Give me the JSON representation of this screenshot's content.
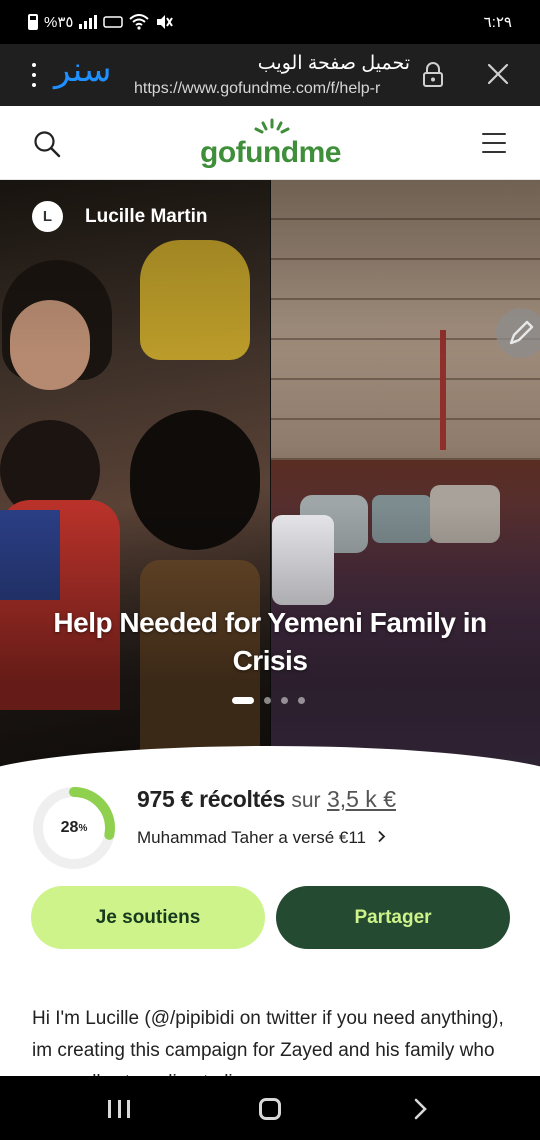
{
  "status_bar": {
    "battery": "%٣٥",
    "time": "٦:٢٩"
  },
  "browser": {
    "brand": "سنر",
    "title": "تحميل صفحة الويب",
    "url": "https://www.gofundme.com/f/help-r"
  },
  "site_header": {
    "logo": "gofundme"
  },
  "hero": {
    "organizer_initial": "L",
    "organizer_name": "Lucille Martin",
    "title": "Help Needed for Yemeni Family in Crisis",
    "slide_count": 4,
    "active_slide": 1
  },
  "progress": {
    "percent_label": "28",
    "percent_symbol": "%",
    "percent_value": 28,
    "raised": "975 € récoltés",
    "of_text": "sur",
    "goal": "3,5 k €",
    "recent_donation": "Muhammad Taher a versé €11"
  },
  "buttons": {
    "donate": "Je soutiens",
    "share": "Partager"
  },
  "story": {
    "text": "Hi I'm Lucille (@/pipibidi on twitter if you need anything), im creating this campaign for Zayed and his family who are really struggling to live"
  },
  "colors": {
    "brand_green": "#3f8f3a",
    "donate_bg": "#cdf38a",
    "share_bg": "#244a31",
    "progress_green": "#8fd14f",
    "browser_brand_blue": "#1e90ff"
  }
}
